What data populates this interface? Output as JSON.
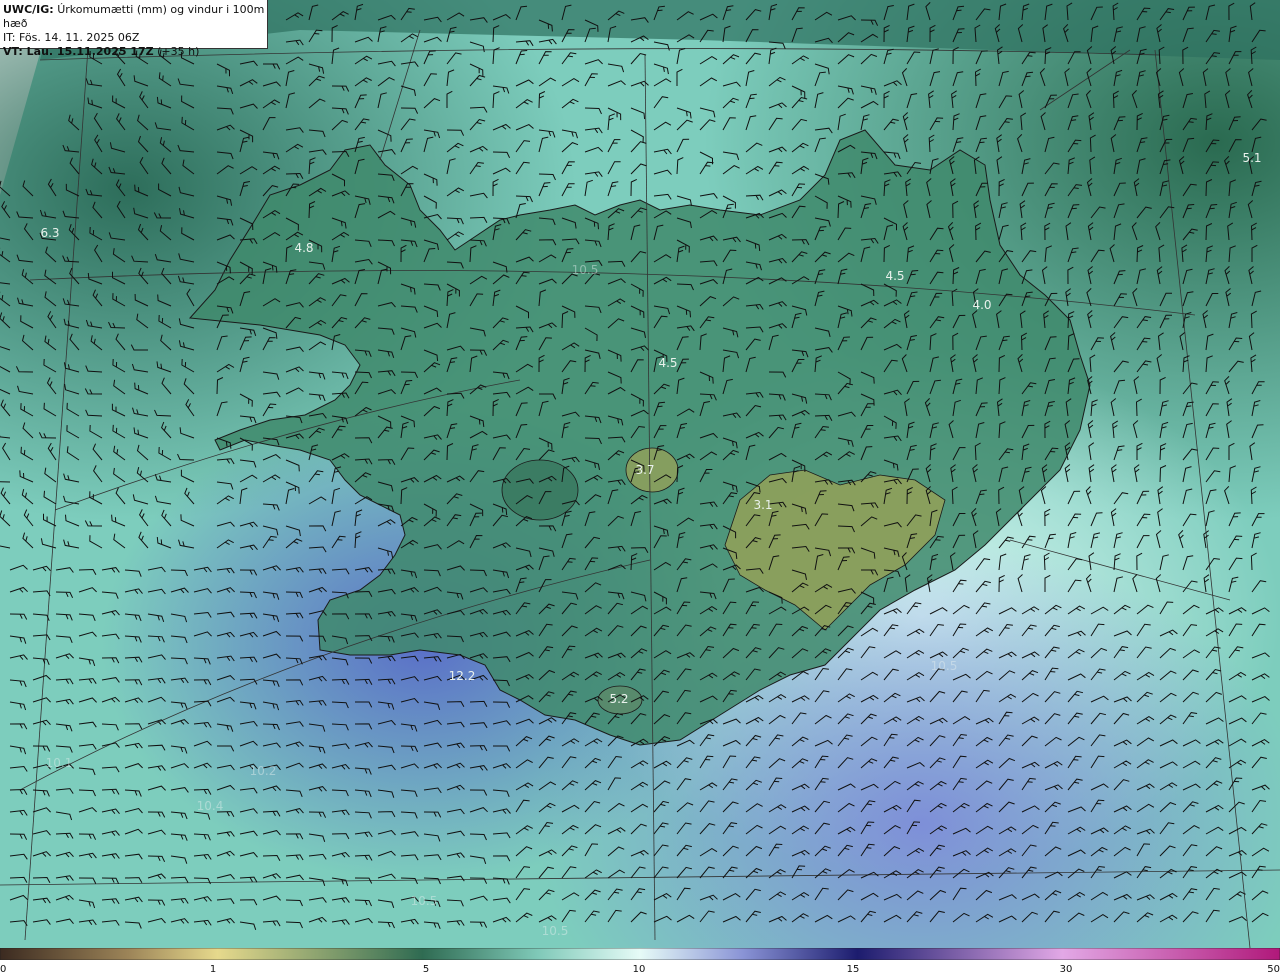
{
  "header": {
    "product": "UWC/IG:",
    "description": "Úrkomumætti (mm) og vindur i 100m hæð",
    "issue_time": "IT: Fös. 14. 11. 2025 06Z",
    "valid_time_bold": "VT: Lau. 15.11.2025 17Z",
    "valid_time_offset": "(+35 h)"
  },
  "map": {
    "region": "Iceland",
    "field": "precipitable water",
    "units": "mm",
    "wind_level": "100m",
    "labels": [
      {
        "text": "6.3",
        "faint": false
      },
      {
        "text": "4.8",
        "faint": false
      },
      {
        "text": "10.5",
        "faint": true
      },
      {
        "text": "4.5",
        "faint": false
      },
      {
        "text": "4.5",
        "faint": false
      },
      {
        "text": "4.0",
        "faint": false
      },
      {
        "text": "5.1",
        "faint": false
      },
      {
        "text": "3.7",
        "faint": false
      },
      {
        "text": "3.1",
        "faint": false
      },
      {
        "text": "5.2",
        "faint": false
      },
      {
        "text": "12.2",
        "faint": false
      },
      {
        "text": "10.5",
        "faint": true
      },
      {
        "text": "10.1",
        "faint": true
      },
      {
        "text": "10.4",
        "faint": true
      },
      {
        "text": "10.2",
        "faint": true
      },
      {
        "text": "10.5",
        "faint": true
      },
      {
        "text": "10.5",
        "faint": true
      }
    ]
  },
  "colorbar": {
    "stops": [
      "#3b2a20",
      "#9c8458",
      "#e6d98c",
      "#2f6b52",
      "#7fc9b8",
      "#e6fbf7",
      "#8a94d6",
      "#1c1c6e",
      "#e2a8e6",
      "#b0187a"
    ],
    "ticks": [
      "0",
      "1",
      "5",
      "10",
      "15",
      "30",
      "50"
    ]
  }
}
